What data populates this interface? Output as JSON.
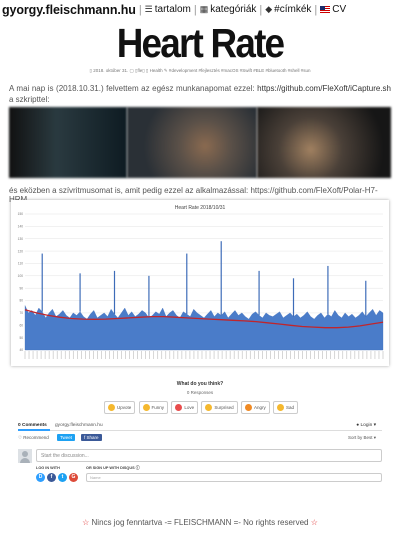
{
  "nav": {
    "site": "gyorgy.fleischmann.hu",
    "items": [
      {
        "icon": "list-icon",
        "label": "tartalom"
      },
      {
        "icon": "grid-icon",
        "label": "kategóriák"
      },
      {
        "icon": "tag-icon",
        "label": "#címkék"
      },
      {
        "icon": "flag-icon",
        "label": "CV"
      }
    ]
  },
  "post": {
    "title": "Heart Rate",
    "meta": "▯ 2018. október 31.  ▢ ▯fle▯   ▯ Health  ✎ #development #fejlesztés #macOS #Swift #BLE #bluetooth #shell #sun",
    "para1_text": "A mai nap is (2018.10.31.) felvettem az egész munkanapomat ezzel: ",
    "para1_link": "https://github.com/FleXoft/iCapture.sh",
    "para1_tail": " a szkripttel:",
    "para2_text": "és eközben a szívritmusomat is, amit pedig ezzel az alkalmazással: ",
    "para2_link": "https://github.com/FleXoft/Polar-H7-HRM"
  },
  "chart_data": {
    "type": "area",
    "title": "Heart Rate 2018/10/31",
    "ylim": [
      40,
      150
    ],
    "yticks": [
      40,
      50,
      60,
      70,
      80,
      90,
      100,
      110,
      120,
      130,
      140,
      150
    ],
    "series": [
      {
        "values": [
          76,
          70,
          72,
          68,
          74,
          71,
          66,
          70,
          73,
          67,
          69,
          72,
          68,
          66,
          70,
          68,
          71,
          67,
          65,
          69,
          72,
          66,
          68,
          70,
          67,
          73,
          69,
          66,
          70,
          74,
          68,
          71,
          67,
          69,
          72,
          70,
          66,
          68,
          71,
          69,
          74,
          67,
          70,
          72,
          68,
          66,
          71,
          69,
          67,
          73,
          70,
          68,
          66,
          69,
          72,
          67,
          70,
          68,
          71,
          66,
          69,
          72,
          68,
          70,
          67,
          65,
          69,
          71,
          68,
          66,
          70,
          68,
          67,
          69,
          71,
          66,
          68,
          70,
          67,
          69,
          66,
          68,
          71,
          67,
          65,
          68,
          70,
          66,
          69,
          67,
          72,
          68,
          66,
          70,
          67,
          69,
          66,
          68,
          71,
          67,
          70,
          73,
          68,
          72,
          70
        ]
      },
      {
        "values": [
          72.5,
          70,
          68,
          66.5,
          65.5,
          65,
          64.8,
          65,
          65.5,
          66,
          66.5,
          67,
          67,
          66.5,
          66,
          65.5,
          65,
          64.5,
          64,
          63.5,
          63,
          62,
          61,
          60,
          59,
          58.5,
          58,
          58,
          58.5,
          59.5,
          61,
          62.5
        ]
      }
    ],
    "spikes": [
      118,
      102,
      104,
      100,
      118,
      128,
      104,
      98,
      108,
      96
    ]
  },
  "comments": {
    "think": "What do you think?",
    "responses": "0 Responses",
    "reactions": [
      {
        "label": "Upvote",
        "color": "#f5b82e"
      },
      {
        "label": "Funny",
        "color": "#f5b82e"
      },
      {
        "label": "Love",
        "color": "#e84c4c"
      },
      {
        "label": "Surprised",
        "color": "#f5b82e"
      },
      {
        "label": "Angry",
        "color": "#f08a24"
      },
      {
        "label": "Sad",
        "color": "#f5b82e"
      }
    ],
    "tab_comments": "0 Comments",
    "tab_site": "gyorgy.fleischmann.hu",
    "login": "● Login ▾",
    "recommend": "♡ Recommend",
    "tweet": "Tweet",
    "share": "f Share",
    "sort": "Sort by Best ▾",
    "placeholder": "Start the discussion...",
    "log_with": "LOG IN WITH",
    "or_sign": "OR SIGN UP WITH DISQUS ⓘ",
    "name_placeholder": "Name"
  },
  "footer": {
    "star_left": "☆",
    "text": "Nincs jog fenntartva -= FLEISCHMANN =- No rights reserved",
    "star_right": "☆"
  }
}
